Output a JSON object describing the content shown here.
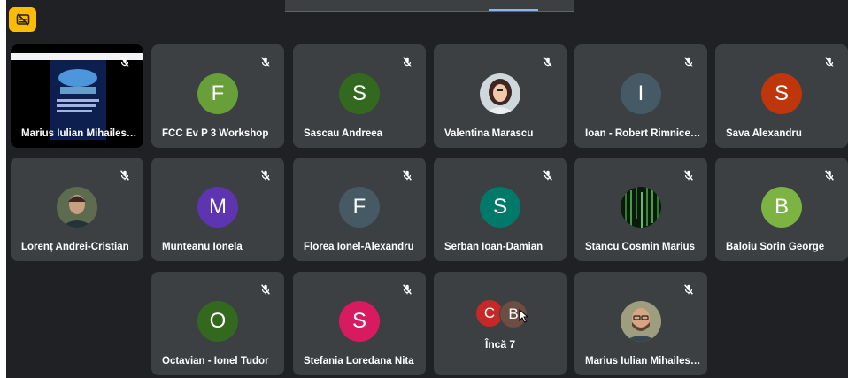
{
  "tiles": [
    {
      "name": "Marius Iulian Mihailesc...",
      "kind": "screen"
    },
    {
      "name": "FCC Ev P 3 Workshop",
      "initial": "F",
      "color": "#689f38"
    },
    {
      "name": "Sascau Andreea",
      "initial": "S",
      "color": "#33691e"
    },
    {
      "name": "Valentina Marascu",
      "photo": "valentina"
    },
    {
      "name": "Ioan - Robert Rimnicea...",
      "initial": "I",
      "color": "#455a64"
    },
    {
      "name": "Sava Alexandru",
      "initial": "S",
      "color": "#bf360c"
    },
    {
      "name": "Lorenț Andrei-Cristian",
      "photo": "lorent"
    },
    {
      "name": "Munteanu Ionela",
      "initial": "M",
      "color": "#5e35b1"
    },
    {
      "name": "Florea Ionel-Alexandru",
      "initial": "F",
      "color": "#455a64"
    },
    {
      "name": "Serban Ioan-Damian",
      "initial": "S",
      "color": "#00796b"
    },
    {
      "name": "Stancu Cosmin Marius",
      "photo": "stancu"
    },
    {
      "name": "Baloiu Sorin George",
      "initial": "B",
      "color": "#7cb342"
    },
    {
      "name": "Octavian - Ionel Tudor",
      "initial": "O",
      "color": "#33691e"
    },
    {
      "name": "Stefania Loredana Nita",
      "initial": "S",
      "color": "#d81b60"
    },
    {
      "name": "Marius Iulian Mihailescu",
      "photo": "marius"
    }
  ],
  "overflow": {
    "label": "Încă 7",
    "avatars": [
      {
        "initial": "C",
        "color": "#c62828"
      },
      {
        "initial": "B",
        "color": "#6d4c41"
      }
    ]
  },
  "colors": {
    "background": "#202124",
    "tile": "#3c4043",
    "captions_button": "#fbbc04"
  },
  "icons": [
    "mic-off-icon",
    "captions-off-icon",
    "cursor-icon"
  ]
}
